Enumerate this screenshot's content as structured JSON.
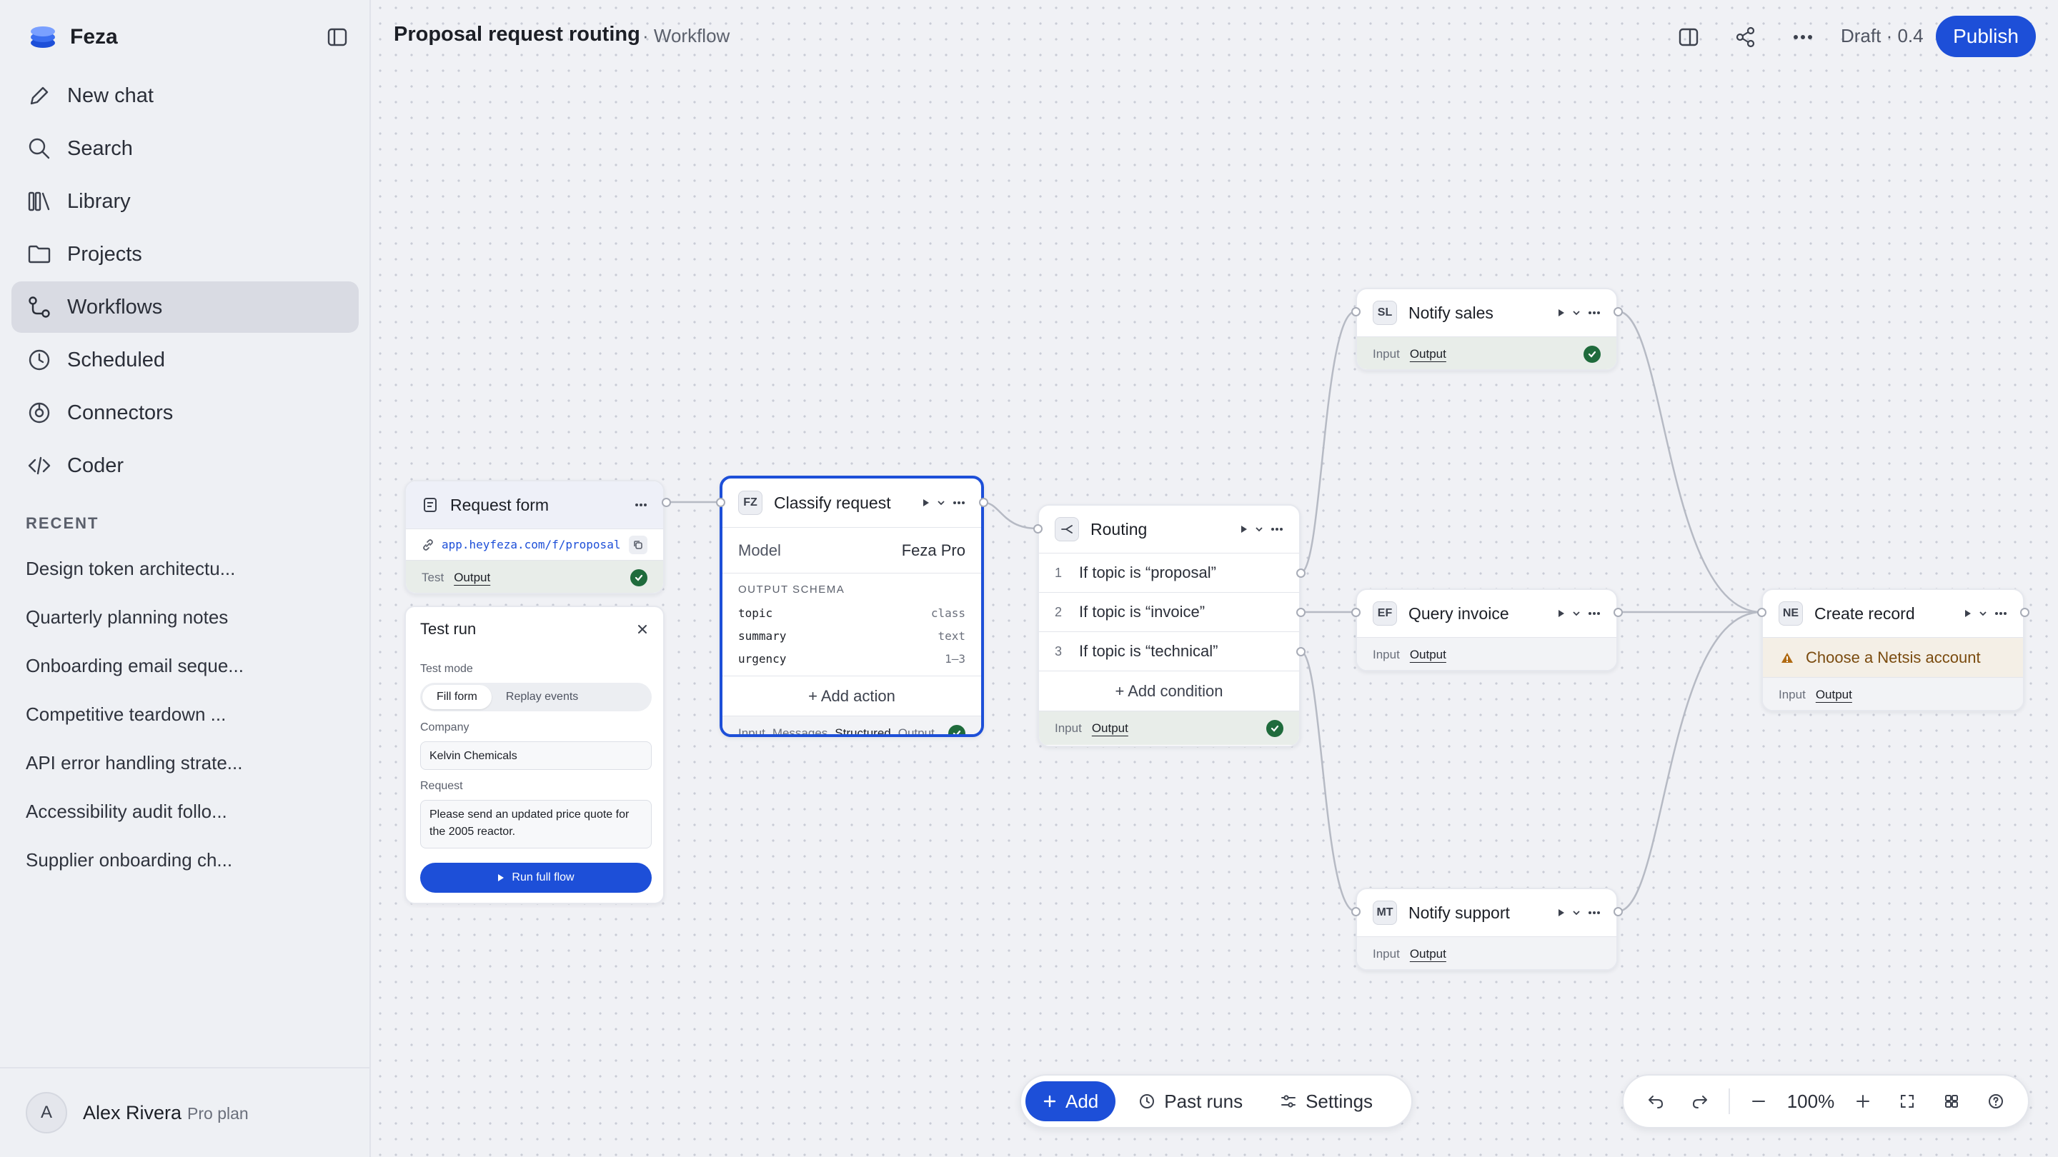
{
  "app": {
    "name": "Feza"
  },
  "nav": [
    {
      "label": "New chat",
      "icon": "pencil-icon"
    },
    {
      "label": "Search",
      "icon": "search-icon"
    },
    {
      "label": "Library",
      "icon": "library-icon"
    },
    {
      "label": "Projects",
      "icon": "folder-icon"
    },
    {
      "label": "Workflows",
      "icon": "workflow-icon",
      "active": true
    },
    {
      "label": "Scheduled",
      "icon": "clock-icon"
    },
    {
      "label": "Connectors",
      "icon": "connector-icon"
    },
    {
      "label": "Coder",
      "icon": "code-icon"
    }
  ],
  "recent": {
    "title": "RECENT",
    "items": [
      "Design token architectu...",
      "Quarterly planning notes",
      "Onboarding email seque...",
      "Competitive teardown ...",
      "API error handling strate...",
      "Accessibility audit follo...",
      "Supplier onboarding ch..."
    ]
  },
  "user": {
    "initial": "A",
    "name": "Alex Rivera",
    "plan": "Pro plan"
  },
  "header": {
    "title": "Proposal request routing",
    "subtitle": "· Workflow",
    "draft": "Draft · 0.4",
    "publish": "Publish"
  },
  "nodes": {
    "request_form": {
      "title": "Request form",
      "url": "app.heyfeza.com/f/proposal",
      "foot_a": "Test",
      "foot_b": "Output"
    },
    "classify": {
      "badge": "FZ",
      "title": "Classify request",
      "model_label": "Model",
      "model_value": "Feza Pro",
      "schema_title": "OUTPUT SCHEMA",
      "schema": [
        {
          "key": "topic",
          "type": "class"
        },
        {
          "key": "summary",
          "type": "text"
        },
        {
          "key": "urgency",
          "type": "1–3"
        }
      ],
      "add": "+ Add action",
      "foot_a": "Input",
      "foot_b": "Messages",
      "foot_c": "Structured",
      "foot_d": "Output"
    },
    "routing": {
      "title": "Routing",
      "conditions": [
        {
          "n": "1",
          "label": "If topic is “proposal”"
        },
        {
          "n": "2",
          "label": "If topic is “invoice”"
        },
        {
          "n": "3",
          "label": "If topic is “technical”"
        }
      ],
      "add": "+ Add condition",
      "foot_a": "Input",
      "foot_b": "Output"
    },
    "notify_sales": {
      "badge": "SL",
      "title": "Notify sales",
      "foot_a": "Input",
      "foot_b": "Output"
    },
    "query_invoice": {
      "badge": "EF",
      "title": "Query invoice",
      "foot_a": "Input",
      "foot_b": "Output"
    },
    "notify_support": {
      "badge": "MT",
      "title": "Notify support",
      "foot_a": "Input",
      "foot_b": "Output"
    },
    "create_record": {
      "badge": "NE",
      "title": "Create record",
      "warning": "Choose a Netsis account",
      "foot_a": "Input",
      "foot_b": "Output"
    }
  },
  "test_run": {
    "title": "Test run",
    "mode_label": "Test mode",
    "modes": [
      "Fill form",
      "Replay events"
    ],
    "company_label": "Company",
    "company_value": "Kelvin Chemicals",
    "request_label": "Request",
    "request_value": "Please send an updated price quote for the 2005 reactor.",
    "run": "Run full flow"
  },
  "toolbar": {
    "add": "Add",
    "past_runs": "Past runs",
    "settings": "Settings"
  },
  "zoom": {
    "value": "100%"
  },
  "colors": {
    "accent": "#1d4fd8",
    "success": "#1f6b3c",
    "warning": "#7a4b0f"
  }
}
